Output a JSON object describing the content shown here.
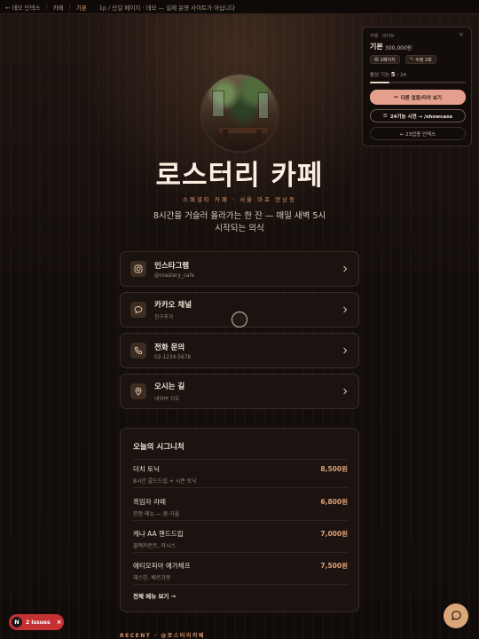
{
  "topbar": {
    "back": "← 데모 인덱스",
    "crumb_cafe": "카페",
    "crumb_current": "기본",
    "notice": "1p / 단일 페이지 · 데모 — 실제 운영 사이트가 아닙니다"
  },
  "hero": {
    "title": "로스터리 카페",
    "subtitle": "스페셜티 카페 · 서울 마포 연남동",
    "tagline": "8시간을 거슬러 올라가는 한 잔 — 매일 새벽 5시 시작되는 의식"
  },
  "links": [
    {
      "name": "인스타그램",
      "sub": "@roastery_cafe",
      "icon": "instagram-icon"
    },
    {
      "name": "카카오 채널",
      "sub": "친구추가",
      "icon": "chat-bubble-icon"
    },
    {
      "name": "전화 문의",
      "sub": "02-1234-5678",
      "icon": "phone-icon"
    },
    {
      "name": "오시는 길",
      "sub": "네이버 지도",
      "icon": "map-pin-icon"
    }
  ],
  "menu": {
    "title": "오늘의 시그니처",
    "items": [
      {
        "name": "더치 토닉",
        "desc": "8시간 콜드드립 + 시즌 토닉",
        "price": "8,500원"
      },
      {
        "name": "흑임자 라떼",
        "desc": "한정 메뉴 — 봄·가을",
        "price": "6,800원"
      },
      {
        "name": "케냐 AA 핸드드립",
        "desc": "블랙커런트, 카시스",
        "price": "7,000원"
      },
      {
        "name": "에티오피아 예가체프",
        "desc": "재스민, 베르가못",
        "price": "7,500원"
      }
    ],
    "more": "전체 메뉴 보기 →"
  },
  "recent": "RECENT · @로스터리카페",
  "panel": {
    "top": "카페 · 라이브",
    "close": "×",
    "name": "기본",
    "price": "300,000원",
    "chip_pages": "1페이지",
    "chip_edits": "수정 2회",
    "active_label": "활성 기능",
    "active_count": "5",
    "active_total": "/ 24",
    "active_fraction": 0.2083,
    "btn_primary": "다른 업종/티어 보기",
    "btn_outline": "24기능 시연 → /showcase",
    "btn_ghost": "← 23업종 인덱스"
  },
  "issues": {
    "logo": "N",
    "label": "2 Issues",
    "close": "×"
  },
  "colors": {
    "accent": "#d7946b",
    "price": "#e0a079",
    "primary_button": "#e4a08c",
    "issues": "#c63234",
    "chat": "#dba679"
  }
}
